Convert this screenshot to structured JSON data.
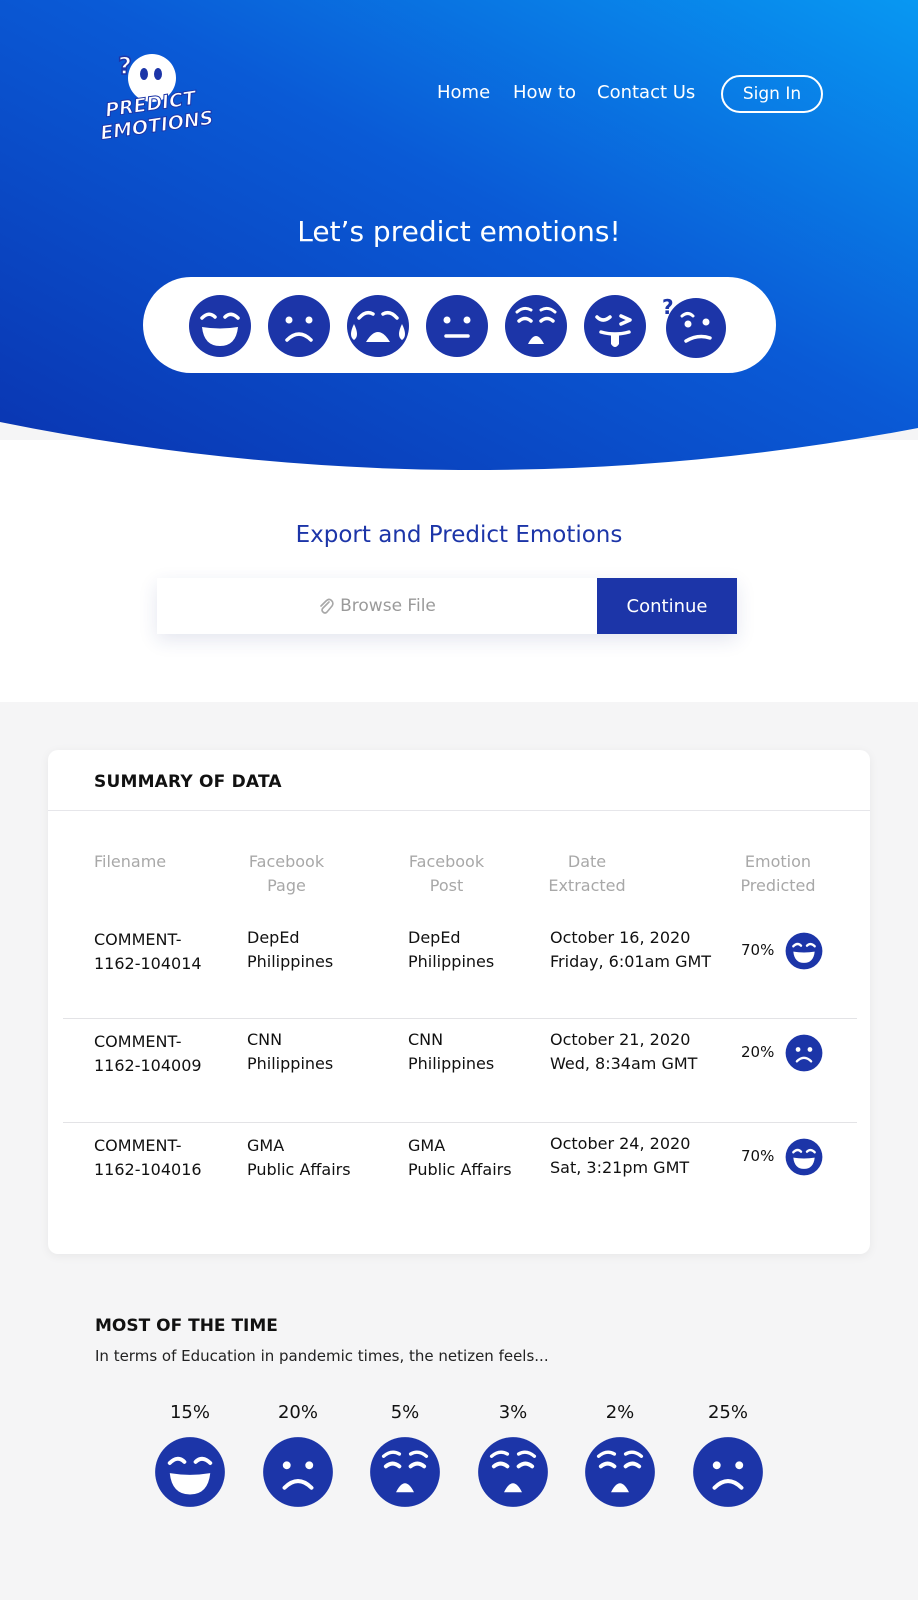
{
  "brand": {
    "logo_line1": "PREDICT",
    "logo_line2": "EMOTIONS"
  },
  "nav": {
    "home": "Home",
    "howto": "How to",
    "contact": "Contact Us",
    "signin": "Sign In"
  },
  "hero": {
    "title": "Let’s predict emotions!",
    "emotions": [
      "happy",
      "sad",
      "crying",
      "neutral",
      "tired",
      "playful",
      "confused"
    ]
  },
  "export": {
    "title": "Export and Predict Emotions",
    "browse_label": "Browse File",
    "continue_label": "Continue"
  },
  "summary": {
    "title": "SUMMARY OF DATA",
    "headers": {
      "filename": "Filename",
      "page_l1": "Facebook",
      "page_l2": "Page",
      "post_l1": "Facebook",
      "post_l2": "Post",
      "date_l1": "Date",
      "date_l2": "Extracted",
      "emotion_l1": "Emotion",
      "emotion_l2": "Predicted"
    },
    "rows": [
      {
        "file_l1": "COMMENT-",
        "file_l2": "1162-104014",
        "page_l1": "DepEd",
        "page_l2": "Philippines",
        "post_l1": "DepEd",
        "post_l2": "Philippines",
        "date_l1": "October 16, 2020",
        "date_l2": "Friday, 6:01am GMT",
        "percent": "70%",
        "emotion": "happy"
      },
      {
        "file_l1": "COMMENT-",
        "file_l2": "1162-104009",
        "page_l1": "CNN",
        "page_l2": "Philippines",
        "post_l1": "CNN",
        "post_l2": "Philippines",
        "date_l1": "October 21, 2020",
        "date_l2": "Wed, 8:34am GMT",
        "percent": "20%",
        "emotion": "sad"
      },
      {
        "file_l1": "COMMENT-",
        "file_l2": "1162-104016",
        "page_l1": "GMA",
        "page_l2": "Public Affairs",
        "post_l1": "GMA",
        "post_l2": "Public Affairs",
        "date_l1": "October 24, 2020",
        "date_l2": "Sat, 3:21pm GMT",
        "percent": "70%",
        "emotion": "happy"
      }
    ]
  },
  "most": {
    "title": "MOST OF THE TIME",
    "subtitle": "In terms of Education in pandemic times, the netizen feels...",
    "stats": [
      {
        "percent": "15%",
        "emotion": "happy"
      },
      {
        "percent": "20%",
        "emotion": "sad"
      },
      {
        "percent": "5%",
        "emotion": "tired"
      },
      {
        "percent": "3%",
        "emotion": "tired"
      },
      {
        "percent": "2%",
        "emotion": "tired"
      },
      {
        "percent": "25%",
        "emotion": "sad"
      }
    ]
  },
  "colors": {
    "primary": "#1c35a8",
    "gradient_start": "#0a3ab4",
    "gradient_end": "#0895f0"
  }
}
